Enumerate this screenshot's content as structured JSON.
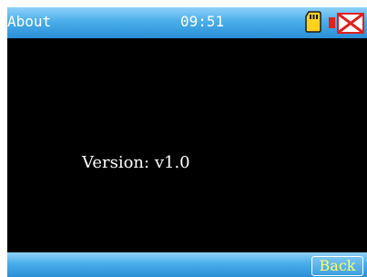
{
  "status_bar": {
    "title": "About",
    "time": "09:51",
    "icons": [
      "sd-card-icon",
      "network-disconnected-icon"
    ]
  },
  "main": {
    "version_label": "Version:",
    "version_value": "v1.0"
  },
  "bottom_bar": {
    "back_label": "Back"
  },
  "colors": {
    "bar_accent": "#4aaeea",
    "screen_background": "#000000",
    "text": "#ffffff",
    "back_text": "#ffff66",
    "sd_card": "#ffd21f",
    "network_error": "#e0211c"
  }
}
